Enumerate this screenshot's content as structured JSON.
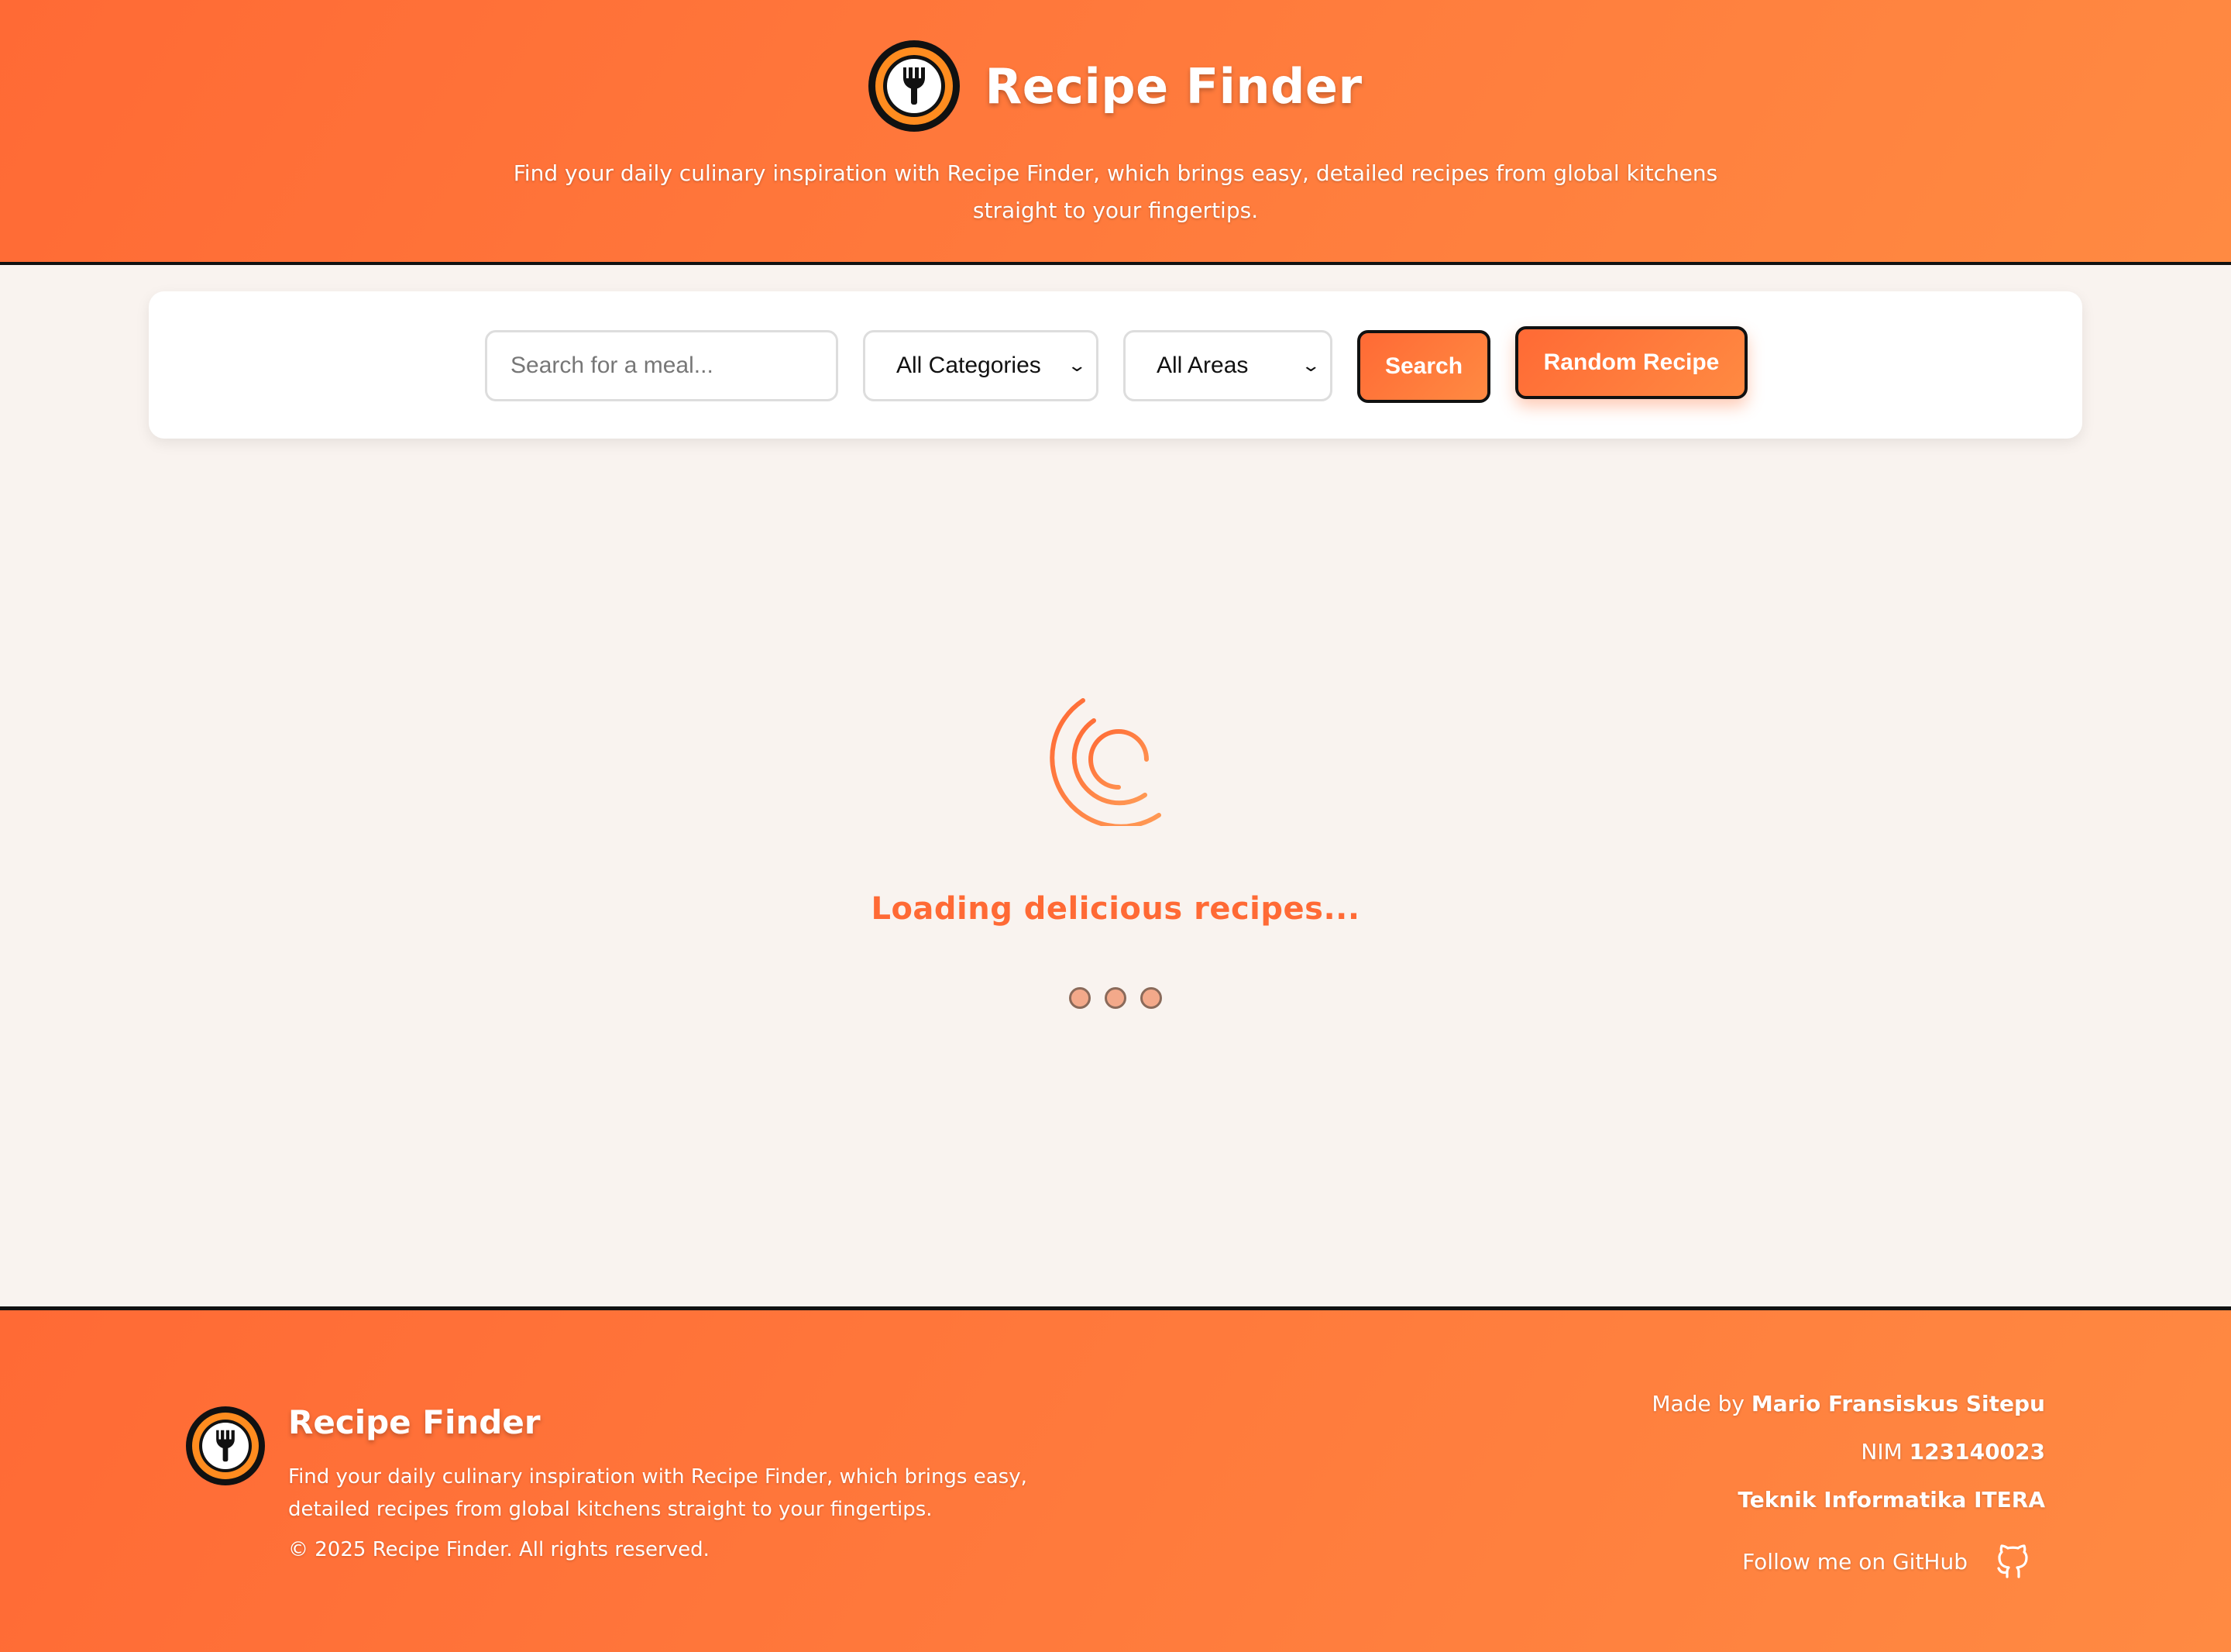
{
  "header": {
    "logo_icon": "fork-icon",
    "title": "Recipe Finder",
    "tagline": "Find your daily culinary inspiration with Recipe Finder, which brings easy, detailed recipes from global kitchens straight to your fingertips."
  },
  "search": {
    "placeholder": "Search for a meal...",
    "value": "",
    "category_selected": "All Categories",
    "area_selected": "All Areas",
    "search_label": "Search",
    "random_label": "Random Recipe"
  },
  "loading": {
    "text": "Loading delicious recipes..."
  },
  "footer": {
    "title": "Recipe Finder",
    "description": "Find your daily culinary inspiration with Recipe Finder, which brings easy, detailed recipes from global kitchens straight to your fingertips.",
    "copyright": "© 2025 Recipe Finder. All rights reserved.",
    "made_by_prefix": "Made by",
    "author": "Mario Fransiskus Sitepu",
    "nim_prefix": "NIM",
    "nim": "123140023",
    "institution": "Teknik Informatika ITERA",
    "github_label": "Follow me on GitHub",
    "github_icon": "github-icon"
  },
  "colors": {
    "accent": "#ff6a35",
    "accent_light": "#ff8a42",
    "logo_ring": "#ff8c1f",
    "background": "#f9f3ef"
  }
}
